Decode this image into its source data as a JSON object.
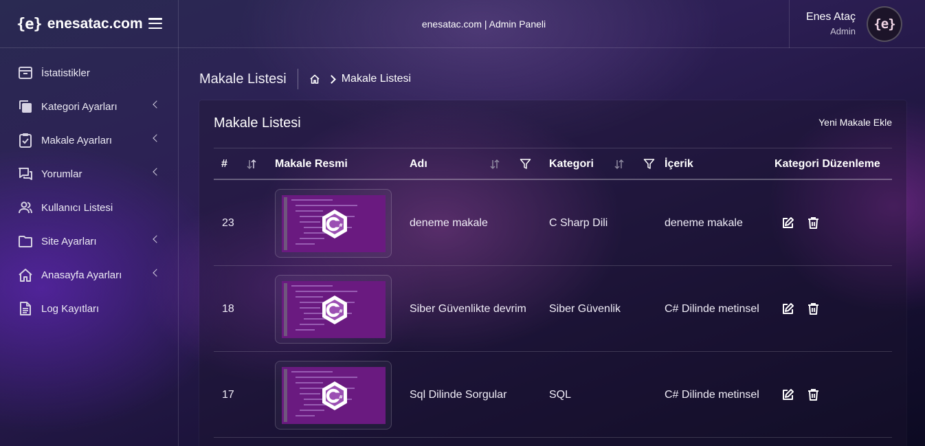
{
  "header": {
    "logo_text": "{e}",
    "brand": "enesatac.com",
    "center_title": "enesatac.com | Admin Paneli",
    "user": {
      "name": "Enes Ataç",
      "role": "Admin",
      "avatar_text": "{e}"
    }
  },
  "sidebar": {
    "items": [
      {
        "label": "İstatistikler",
        "icon": "inbox-icon",
        "has_submenu": false
      },
      {
        "label": "Kategori Ayarları",
        "icon": "copy-icon",
        "has_submenu": true
      },
      {
        "label": "Makale Ayarları",
        "icon": "clipboard-check-icon",
        "has_submenu": true
      },
      {
        "label": "Yorumlar",
        "icon": "chat-icon",
        "has_submenu": true
      },
      {
        "label": "Kullanıcı Listesi",
        "icon": "users-icon",
        "has_submenu": false
      },
      {
        "label": "Site Ayarları",
        "icon": "folder-icon",
        "has_submenu": true
      },
      {
        "label": "Anasayfa Ayarları",
        "icon": "home-icon",
        "has_submenu": true
      },
      {
        "label": "Log Kayıtları",
        "icon": "file-text-icon",
        "has_submenu": false
      }
    ]
  },
  "breadcrumb": {
    "page_title": "Makale Listesi",
    "current": "Makale Listesi"
  },
  "card": {
    "title": "Makale Listesi",
    "add_link": "Yeni Makale Ekle"
  },
  "table": {
    "columns": {
      "id": "#",
      "image": "Makale Resmi",
      "name": "Adı",
      "category": "Kategori",
      "content": "İçerik",
      "actions": "Kategori Düzenleme"
    },
    "rows": [
      {
        "id": "23",
        "name": "deneme makale",
        "category": "C Sharp Dili",
        "content": "deneme makale"
      },
      {
        "id": "18",
        "name": "Siber Güvenlikte devrim",
        "category": "Siber Güvenlik",
        "content": "C# Dilinde metinsel"
      },
      {
        "id": "17",
        "name": "Sql Dilinde Sorgular",
        "category": "SQL",
        "content": "C# Dilinde metinsel"
      }
    ]
  },
  "colors": {
    "accent_purple": "#6a1a80",
    "hex_logo": "#ffffff"
  }
}
